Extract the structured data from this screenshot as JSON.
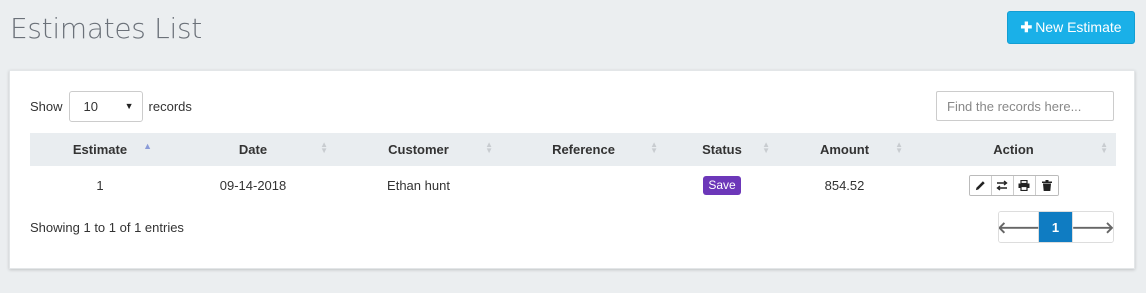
{
  "page": {
    "title": "Estimates List"
  },
  "header": {
    "new_button_label": "New Estimate",
    "new_button_icon": "plus-icon"
  },
  "controls": {
    "show_label": "Show",
    "records_label": "records",
    "page_length": "10",
    "search_placeholder": "Find the records here..."
  },
  "table": {
    "columns": [
      "Estimate",
      "Date",
      "Customer",
      "Reference",
      "Status",
      "Amount",
      "Action"
    ],
    "rows": [
      {
        "estimate": "1",
        "date": "09-14-2018",
        "customer": "Ethan hunt",
        "reference": "",
        "status": "Save",
        "amount": "854.52",
        "actions": [
          "edit-icon",
          "convert-icon",
          "print-icon",
          "delete-icon"
        ]
      }
    ]
  },
  "footer": {
    "info": "Showing 1 to 1 of 1 entries",
    "current_page": "1"
  },
  "colors": {
    "accent": "#1ab0e8",
    "status_save": "#6c37b9",
    "pager_active": "#0f7cc2"
  }
}
